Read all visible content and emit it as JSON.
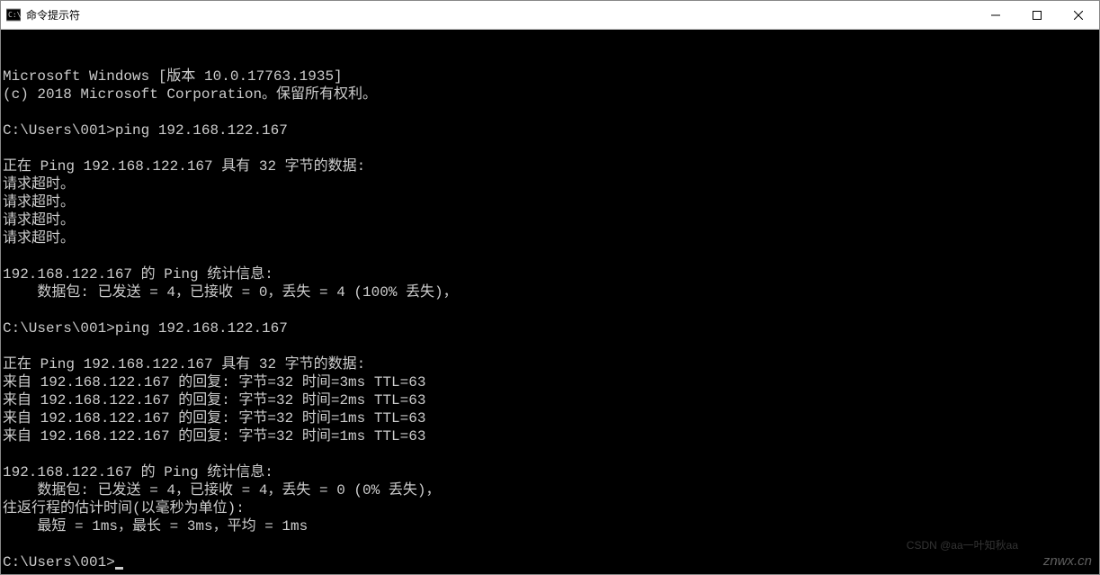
{
  "window": {
    "title": "命令提示符"
  },
  "terminal": {
    "lines": [
      "Microsoft Windows [版本 10.0.17763.1935]",
      "(c) 2018 Microsoft Corporation。保留所有权利。",
      "",
      "C:\\Users\\001>ping 192.168.122.167",
      "",
      "正在 Ping 192.168.122.167 具有 32 字节的数据:",
      "请求超时。",
      "请求超时。",
      "请求超时。",
      "请求超时。",
      "",
      "192.168.122.167 的 Ping 统计信息:",
      "    数据包: 已发送 = 4，已接收 = 0，丢失 = 4 (100% 丢失)，",
      "",
      "C:\\Users\\001>ping 192.168.122.167",
      "",
      "正在 Ping 192.168.122.167 具有 32 字节的数据:",
      "来自 192.168.122.167 的回复: 字节=32 时间=3ms TTL=63",
      "来自 192.168.122.167 的回复: 字节=32 时间=2ms TTL=63",
      "来自 192.168.122.167 的回复: 字节=32 时间=1ms TTL=63",
      "来自 192.168.122.167 的回复: 字节=32 时间=1ms TTL=63",
      "",
      "192.168.122.167 的 Ping 统计信息:",
      "    数据包: 已发送 = 4，已接收 = 4，丢失 = 0 (0% 丢失)，",
      "往返行程的估计时间(以毫秒为单位):",
      "    最短 = 1ms，最长 = 3ms，平均 = 1ms",
      "",
      "C:\\Users\\001>"
    ],
    "prompt_cursor": true
  },
  "watermark": {
    "main": "znwx.cn",
    "sub": "CSDN @aa一叶知秋aa"
  }
}
